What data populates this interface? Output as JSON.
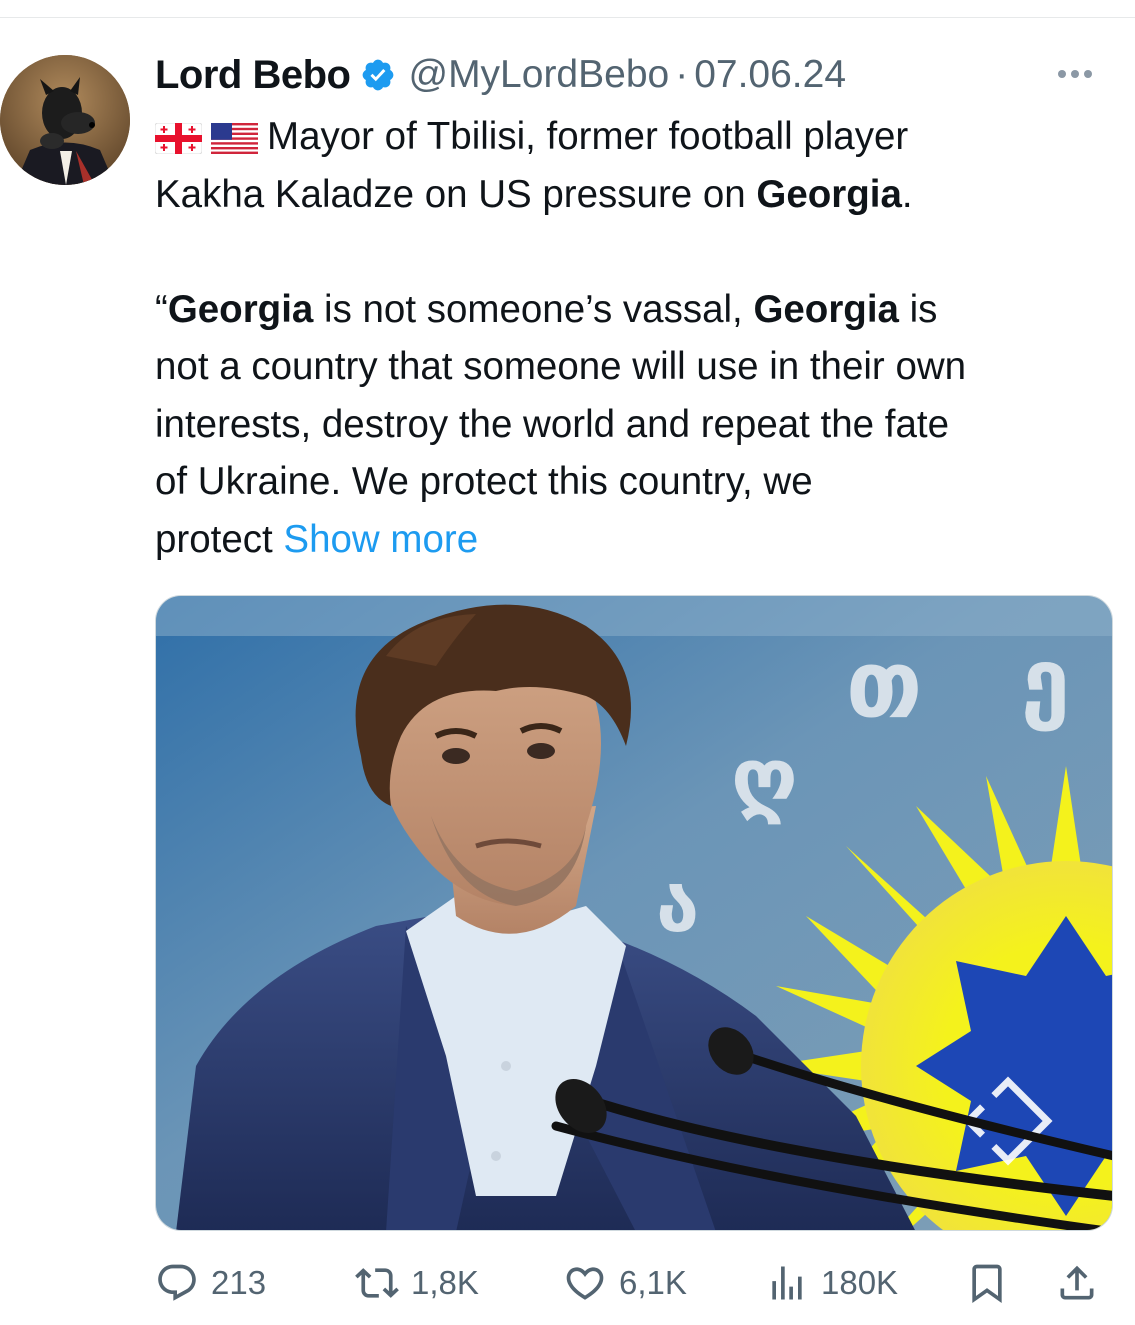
{
  "post": {
    "author": {
      "display_name": "Lord Bebo",
      "handle": "@MyLordBebo",
      "verified_badge_icon": "verified-badge-icon",
      "avatar_icon": "avatar-dog-portrait"
    },
    "separator": "·",
    "date": "07.06.24",
    "more_icon": "more-dots-icon",
    "text": {
      "flags": [
        "georgia-flag-icon",
        "usa-flag-icon"
      ],
      "line1": "Mayor of Tbilisi, former football player",
      "line2_pre": "Kakha Kaladze on US pressure on ",
      "line2_bold": "Georgia",
      "line2_post": ".",
      "quote_open": "“",
      "q_bold1": "Georgia",
      "q_text1": " is not someone’s vassal, ",
      "q_bold2": "Georgia",
      "q_text2": " is",
      "q_line2": "not a country that someone will use in their own",
      "q_line3": "interests, destroy the world and repeat the fate",
      "q_line4": "of Ukraine. We protect this country, we",
      "q_line5": "protect ",
      "show_more": "Show more"
    },
    "media": {
      "description_icon": "photo-man-at-microphones",
      "georgian_glyphs": [
        "თ",
        "ე",
        "ღ",
        "ა"
      ]
    },
    "actions": {
      "reply": {
        "icon": "reply-icon",
        "count": "213"
      },
      "repost": {
        "icon": "repost-icon",
        "count": "1,8K"
      },
      "like": {
        "icon": "heart-icon",
        "count": "6,1K"
      },
      "views": {
        "icon": "views-chart-icon",
        "count": "180K"
      },
      "bookmark": {
        "icon": "bookmark-icon"
      },
      "share": {
        "icon": "share-icon"
      }
    }
  },
  "colors": {
    "accent": "#1d9bf0",
    "text_primary": "#0f1419",
    "text_secondary": "#536471",
    "verified": "#1d9bf0"
  }
}
